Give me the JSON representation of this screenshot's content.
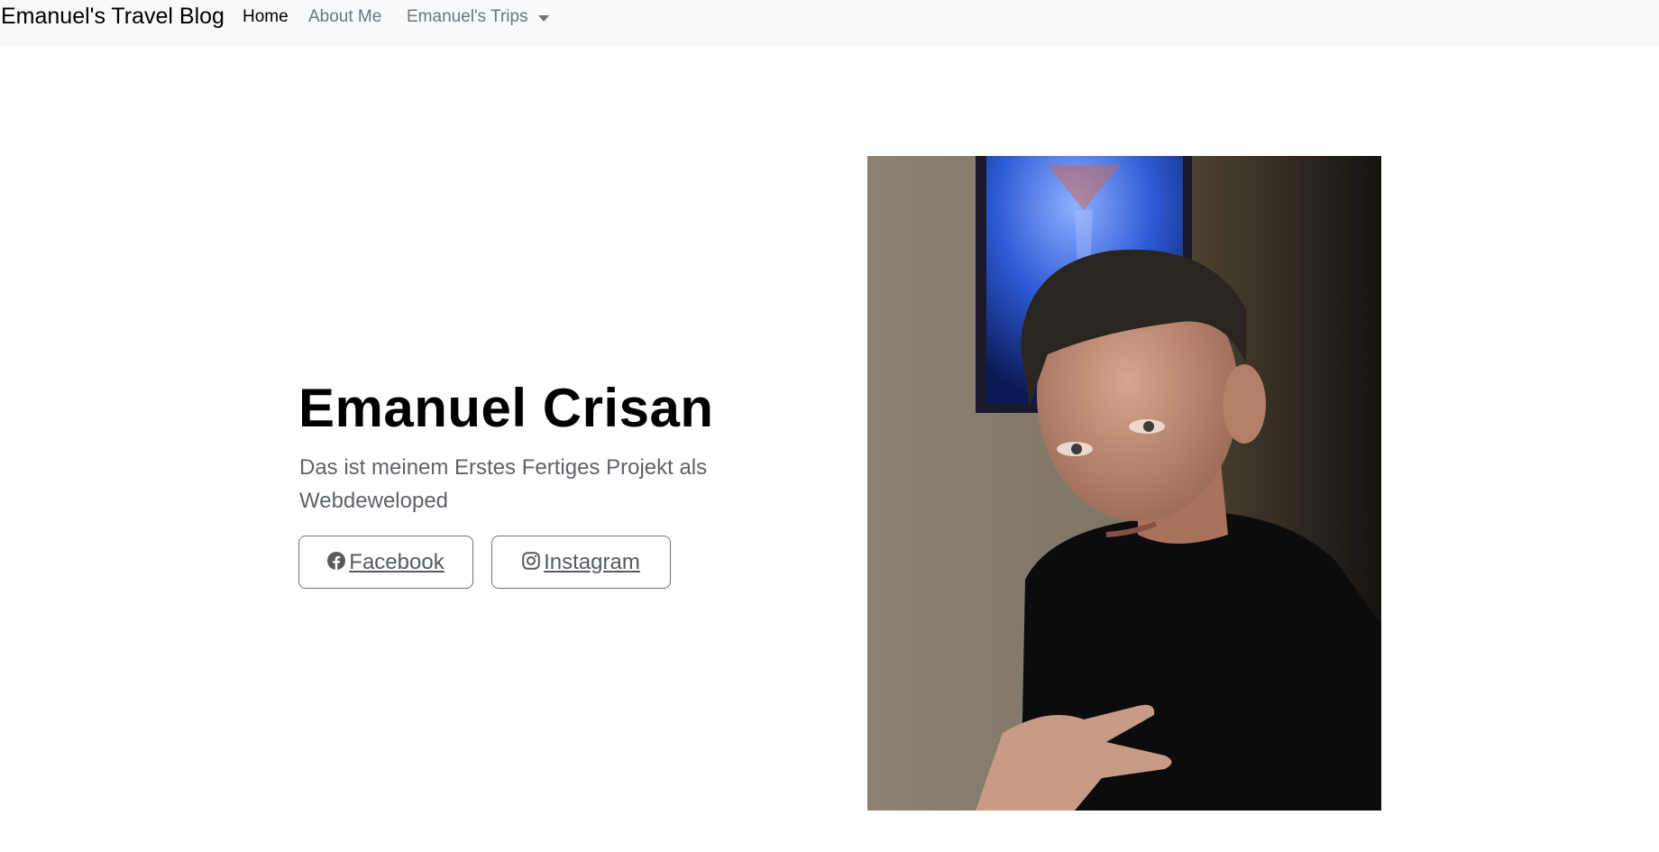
{
  "navbar": {
    "brand": "Emanuel's Travel Blog",
    "links": [
      {
        "label": "Home",
        "active": true
      },
      {
        "label": "About Me",
        "active": false
      },
      {
        "label": "Emanuel's Trips",
        "active": false,
        "dropdown": true
      }
    ]
  },
  "hero": {
    "title": "Emanuel Crisan",
    "lead": "Das ist meinem Erstes Fertiges Projekt als Webdeweloped",
    "buttons": [
      {
        "label": " Facebook",
        "icon": "facebook-icon"
      },
      {
        "label": " Instagram",
        "icon": "instagram-icon"
      }
    ]
  },
  "colors": {
    "navbar_bg": "#f8f9fa",
    "text_muted": "#6c757d",
    "title": "#000000"
  }
}
